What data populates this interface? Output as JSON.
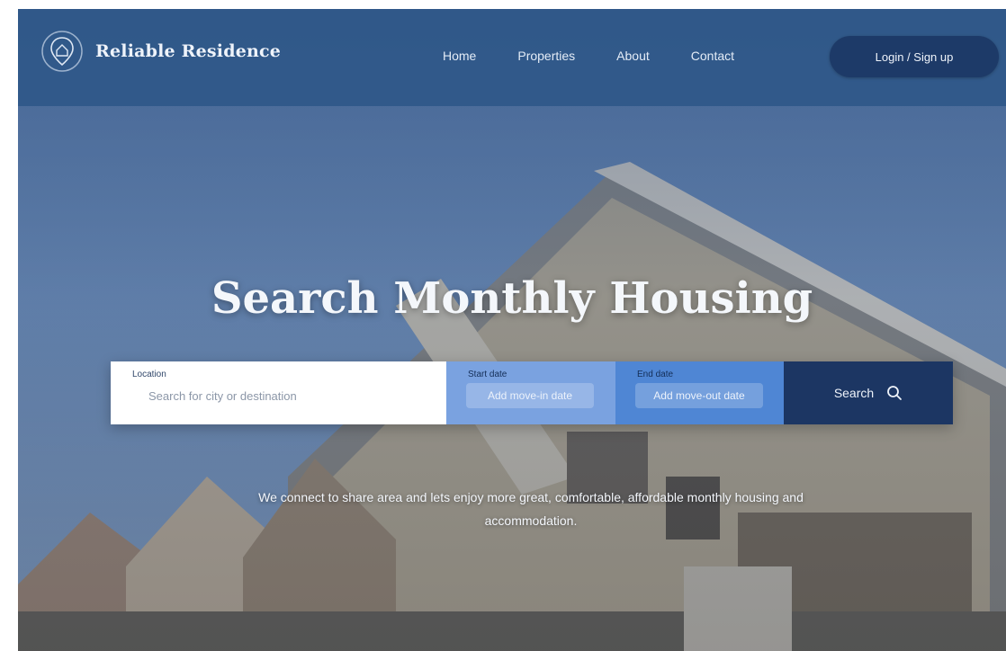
{
  "brand": {
    "name": "Reliable Residence",
    "logo_icon": "house-pin-logo-icon"
  },
  "nav": {
    "items": [
      {
        "label": "Home"
      },
      {
        "label": "Properties"
      },
      {
        "label": "About"
      },
      {
        "label": "Contact"
      }
    ]
  },
  "header": {
    "cta_label": "Login / Sign up"
  },
  "hero": {
    "title": "Search Monthly Housing",
    "tagline": "We connect to share area and lets enjoy more great, comfortable, affordable monthly housing and accommodation."
  },
  "search": {
    "location": {
      "label": "Location",
      "placeholder": "Search for city or destination"
    },
    "start": {
      "label": "Start date",
      "value": "Add move-in date"
    },
    "end": {
      "label": "End date",
      "value": "Add move-out date"
    },
    "button_label": "Search",
    "button_icon": "search-icon"
  },
  "colors": {
    "header_bg": "#2e5688",
    "cta_bg": "#1d3a68",
    "start_bg": "#7aa2e0",
    "end_bg": "#4f86d4",
    "search_btn_bg": "#1c3663"
  }
}
